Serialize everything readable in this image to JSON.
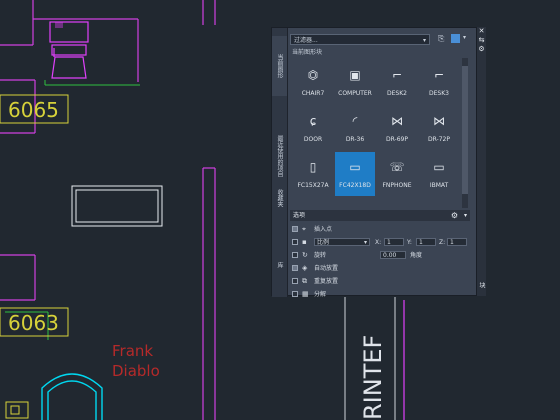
{
  "drawing": {
    "room_numbers": [
      "6065",
      "6063"
    ],
    "name_label": [
      "Frank",
      "Diablo"
    ],
    "vertical_label": "RINTEF"
  },
  "palette": {
    "side_tabs": [
      "当前图形",
      "最近使用的项目",
      "收藏夹",
      "库"
    ],
    "filter_text": "过滤器...",
    "section_label": "当前图形块",
    "blocks": [
      {
        "name": "CHAIR7",
        "icon": "chair-icon"
      },
      {
        "name": "COMPUTER",
        "icon": "computer-icon"
      },
      {
        "name": "DESK2",
        "icon": "desk-icon"
      },
      {
        "name": "DESK3",
        "icon": "desk-icon"
      },
      {
        "name": "DOOR",
        "icon": "door-icon"
      },
      {
        "name": "DR-36",
        "icon": "door-swing-icon"
      },
      {
        "name": "DR-69P",
        "icon": "double-door-icon"
      },
      {
        "name": "DR-72P",
        "icon": "double-door-icon"
      },
      {
        "name": "FC15X27A",
        "icon": "phone-icon"
      },
      {
        "name": "FC42X18D",
        "icon": "rectangle-icon"
      },
      {
        "name": "FNPHONE",
        "icon": "fnphone-icon"
      },
      {
        "name": "IBMAT",
        "icon": "rectangle-icon"
      }
    ],
    "selected_block": "FC42X18D",
    "options_label": "选项",
    "options": {
      "insertion_point": "插入点",
      "scale_value": "比例",
      "x_label": "X:",
      "x_value": "1",
      "y_label": "Y:",
      "y_value": "1",
      "z_label": "Z:",
      "z_value": "1",
      "rotation": "旋转",
      "angle_value": "0.00",
      "angle_label": "角度",
      "auto_place": "自动放置",
      "repeat_place": "重复放置",
      "explode": "分解"
    },
    "title": "块",
    "colors": {
      "selection": "#1f7dc6",
      "cyan": "#00e5ff",
      "magenta": "#e040fb",
      "yellow": "#d7d23a",
      "red": "#b52a2a"
    }
  }
}
